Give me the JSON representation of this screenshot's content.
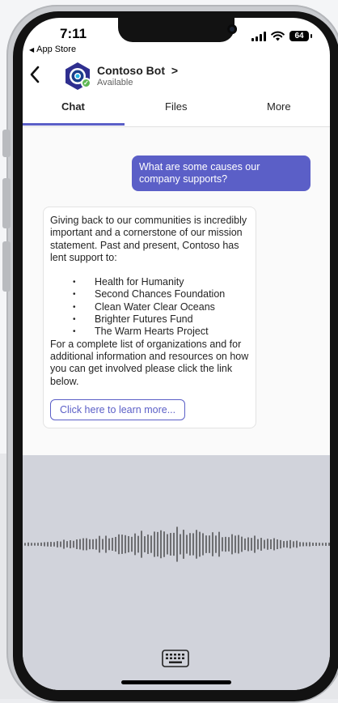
{
  "status_bar": {
    "time": "7:11",
    "back_app": "App Store",
    "battery": "64"
  },
  "header": {
    "bot_name": "Contoso Bot",
    "bot_chevron": ">",
    "bot_status": "Available"
  },
  "tabs": {
    "chat": "Chat",
    "files": "Files",
    "more": "More"
  },
  "messages": {
    "user_text": "What are some causes our company supports?",
    "bot_intro": "Giving back to our communities is incredibly important and a cornerstone of our mission statement. Past and present, Contoso has lent support to:",
    "bot_list": [
      "Health for Humanity",
      "Second Chances Foundation",
      "Clean Water Clear Oceans",
      "Brighter Futures Fund",
      "The Warm Hearts Project"
    ],
    "bot_outro": "For a complete list of organizations and for additional information and resources on how you can get involved please click the link below.",
    "learn_more_label": "Click here to learn more..."
  },
  "icons": {
    "back": "chevron-left-icon",
    "avatar": "contoso-bot-avatar",
    "presence": "presence-available-icon",
    "keyboard": "keyboard-icon",
    "waveform": "voice-waveform"
  },
  "colors": {
    "accent": "#5b5fc7",
    "presence_green": "#5fb854",
    "voice_panel": "#d1d3db"
  }
}
